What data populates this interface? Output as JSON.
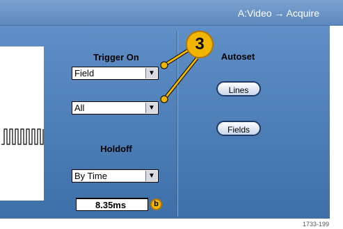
{
  "header": {
    "title": "A:Video → Acquire"
  },
  "trigger": {
    "label": "Trigger On",
    "selects": [
      {
        "value": "Field"
      },
      {
        "value": "All"
      }
    ]
  },
  "holdoff": {
    "label": "Holdoff",
    "mode": "By Time",
    "value": "8.35ms"
  },
  "autoset": {
    "label": "Autoset",
    "buttons": [
      {
        "label": "Lines"
      },
      {
        "label": "Fields"
      }
    ]
  },
  "callouts": {
    "step": "3",
    "knob": "b"
  },
  "figure_number": "1733-199",
  "icons": {
    "dropdown": "chevron-down-icon",
    "knob": "knob-b-icon"
  },
  "colors": {
    "callout": "#f2b600",
    "panel": "#5f8fc6"
  }
}
